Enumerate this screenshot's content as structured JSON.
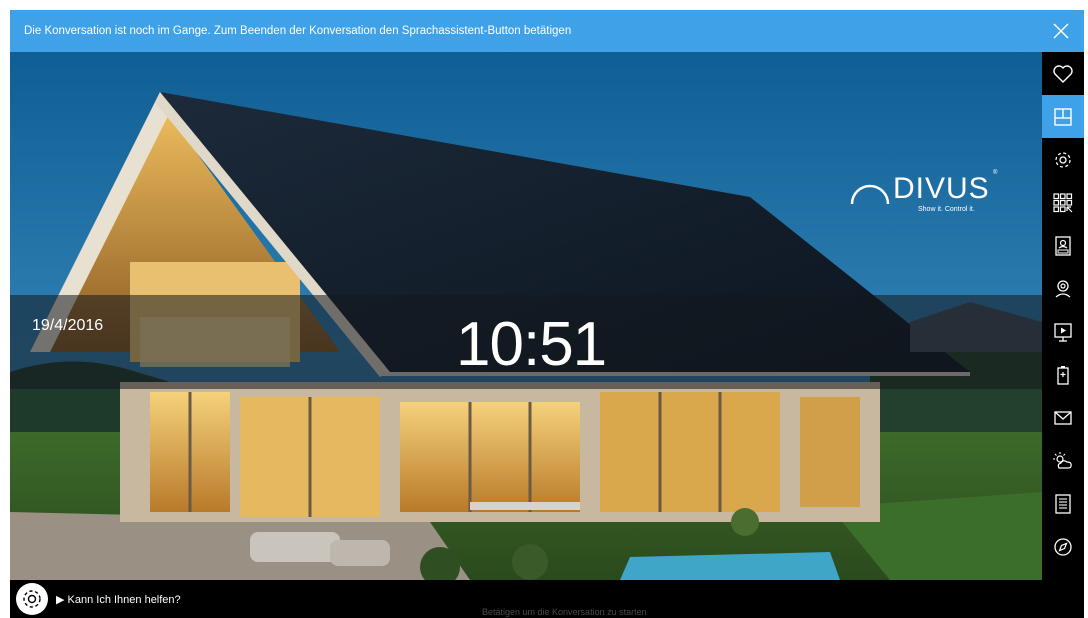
{
  "notice": {
    "text": "Die Konversation ist noch im Gange. Zum Beenden der Konversation den Sprachassistent-Button betätigen",
    "close_icon": "close-icon"
  },
  "clock": {
    "date": "19/4/2016",
    "time": "10:51"
  },
  "logo": {
    "name": "DIVUS",
    "slogan": "Show it. Control it.",
    "registered": "®"
  },
  "sidebar": {
    "items": [
      {
        "icon": "heart-icon",
        "active": false
      },
      {
        "icon": "floorplan-icon",
        "active": true
      },
      {
        "icon": "gear-icon",
        "active": false
      },
      {
        "icon": "grid-apps-icon",
        "active": false
      },
      {
        "icon": "intercom-icon",
        "active": false
      },
      {
        "icon": "user-location-icon",
        "active": false
      },
      {
        "icon": "media-player-icon",
        "active": false
      },
      {
        "icon": "battery-icon",
        "active": false
      },
      {
        "icon": "mail-icon",
        "active": false
      },
      {
        "icon": "weather-icon",
        "active": false
      },
      {
        "icon": "list-icon",
        "active": false
      },
      {
        "icon": "compass-icon",
        "active": false
      }
    ]
  },
  "assistant": {
    "prompt": "▶ Kann Ich Ihnen helfen?",
    "hint": "Betätigen um die Konversation zu starten"
  },
  "colors": {
    "accent": "#3fa2e8",
    "sidebar_bg": "#000000"
  }
}
